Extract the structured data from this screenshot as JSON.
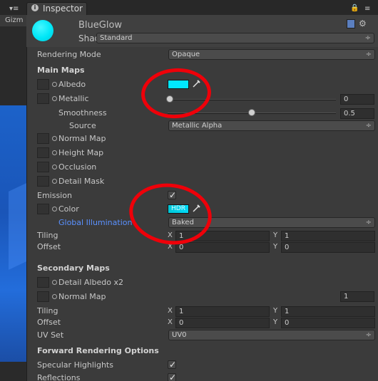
{
  "window": {
    "left_tab": "Gizm",
    "tab_title": "Inspector",
    "lock_icon": "lock-icon",
    "menu_icon": "menu-icon"
  },
  "material": {
    "name": "BlueGlow",
    "shader_label": "Shader",
    "shader_value": "Standard"
  },
  "properties": {
    "rendering_mode_label": "Rendering Mode",
    "rendering_mode_value": "Opaque",
    "main_maps": "Main Maps",
    "albedo": "Albedo",
    "metallic": "Metallic",
    "metallic_value": "0",
    "smoothness": "Smoothness",
    "smoothness_value": "0.5",
    "source_label": "Source",
    "source_value": "Metallic Alpha",
    "normal_map": "Normal Map",
    "height_map": "Height Map",
    "occlusion": "Occlusion",
    "detail_mask": "Detail Mask",
    "emission": "Emission",
    "color": "Color",
    "hdr": "HDR",
    "global_illumination": "Global Illumination",
    "global_illumination_value": "Baked",
    "tiling": "Tiling",
    "offset": "Offset",
    "x": "X",
    "y": "Y",
    "main_tiling_x": "1",
    "main_tiling_y": "1",
    "main_offset_x": "0",
    "main_offset_y": "0",
    "secondary_maps": "Secondary Maps",
    "detail_albedo": "Detail Albedo x2",
    "secondary_normal_map": "Normal Map",
    "secondary_normal_value": "1",
    "secondary_tiling_x": "1",
    "secondary_tiling_y": "1",
    "secondary_offset_x": "0",
    "secondary_offset_y": "0",
    "uv_set": "UV Set",
    "uv_set_value": "UV0",
    "forward_rendering": "Forward Rendering Options",
    "specular_highlights": "Specular Highlights",
    "reflections": "Reflections"
  },
  "colors": {
    "albedo": "#00e8ff",
    "emission": "#00d9f7",
    "annotation": "#ef0009",
    "global_illumination_label": "#5a91ff"
  },
  "state": {
    "emission_enabled": true,
    "specular_highlights_enabled": true,
    "reflections_enabled": true,
    "smoothness": 0.5,
    "metallic": 0
  }
}
